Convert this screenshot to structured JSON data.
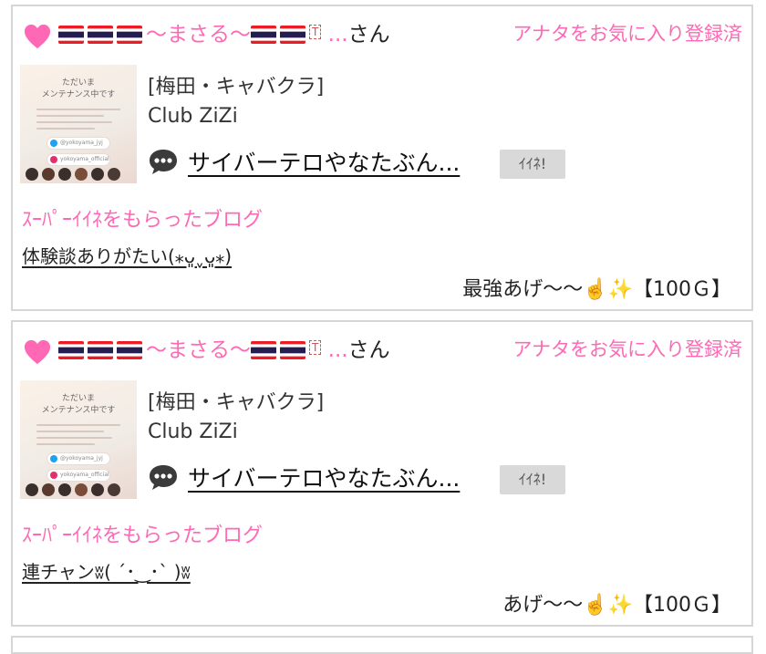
{
  "cards": [
    {
      "user_name": "〜まさる〜",
      "name_suffix": "...",
      "san": "さん",
      "favorite_status": "アナタをお気に入り登録済",
      "area": "[梅田・キャバクラ]",
      "shop": "Club ZiZi",
      "blog_title": "サイバーテロやなたぶん...",
      "iine_label": "ｲｲﾈ!",
      "section_title": "ｽｰﾊﾟｰｲｲﾈをもらったブログ",
      "comment": "体験談ありがたい(⁎ᴗ͈ˬᴗ͈⁎)",
      "gift_message": "最強あげ〜〜☝️✨【100Ｇ】"
    },
    {
      "user_name": "〜まさる〜",
      "name_suffix": "...",
      "san": "さん",
      "favorite_status": "アナタをお気に入り登録済",
      "area": "[梅田・キャバクラ]",
      "shop": "Club ZiZi",
      "blog_title": "サイバーテロやなたぶん...",
      "iine_label": "ｲｲﾈ!",
      "section_title": "ｽｰﾊﾟｰｲｲﾈをもらったブログ",
      "comment": "連チャンʬ( ´･‿･` )ʬ",
      "gift_message": "あげ〜〜☝️✨【100Ｇ】"
    }
  ],
  "thumbnail": {
    "heading_line1": "ただいま",
    "heading_line2": "メンテナンス中です",
    "handle_twitter": "@yokoyama_jyj",
    "handle_instagram": "yokoyama_official"
  },
  "colors": {
    "accent_pink": "#ff68b4",
    "border": "#d6d6d6",
    "button_gray": "#d9d9d9"
  },
  "icons": [
    "heart-icon",
    "thai-flag-icon",
    "t-symbol-icon",
    "speech-bubble-icon",
    "point-up-icon",
    "sparkles-icon"
  ]
}
